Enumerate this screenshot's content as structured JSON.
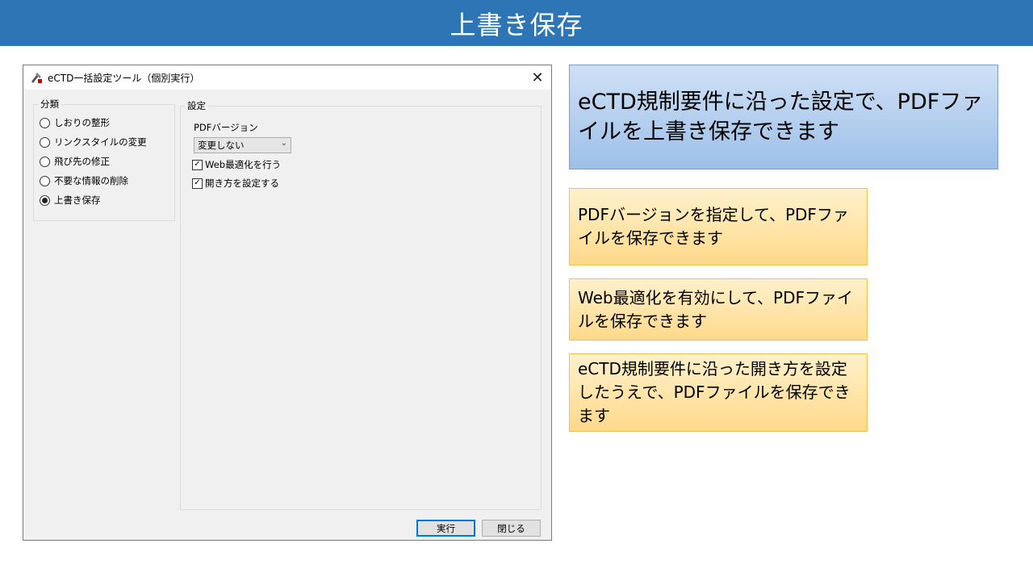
{
  "banner": {
    "title": "上書き保存"
  },
  "dialog": {
    "title": "eCTD一括設定ツール（個別実行）",
    "category_group_label": "分類",
    "categories": [
      {
        "label": "しおりの整形",
        "selected": false
      },
      {
        "label": "リンクスタイルの変更",
        "selected": false
      },
      {
        "label": "飛び先の修正",
        "selected": false
      },
      {
        "label": "不要な情報の削除",
        "selected": false
      },
      {
        "label": "上書き保存",
        "selected": true
      }
    ],
    "settings_group_label": "設定",
    "pdf_version_label": "PDFバージョン",
    "pdf_version_value": "変更しない",
    "checkboxes": [
      {
        "label": "Web最適化を行う",
        "checked": true
      },
      {
        "label": "開き方を設定する",
        "checked": true
      }
    ],
    "run_button": "実行",
    "close_button": "閉じる"
  },
  "callouts": {
    "main": "eCTD規制要件に沿った設定で、PDFファイルを上書き保存できます",
    "items": [
      "PDFバージョンを指定して、PDFファイルを保存できます",
      "Web最適化を有効にして、PDFファイルを保存できます",
      "eCTD規制要件に沿った開き方を設定したうえで、PDFファイルを保存できます"
    ]
  },
  "colors": {
    "banner": "#2e75b6",
    "main_callout": "#9dc0e8",
    "callout": "#ffd98a",
    "default_button_border": "#0078d7"
  }
}
